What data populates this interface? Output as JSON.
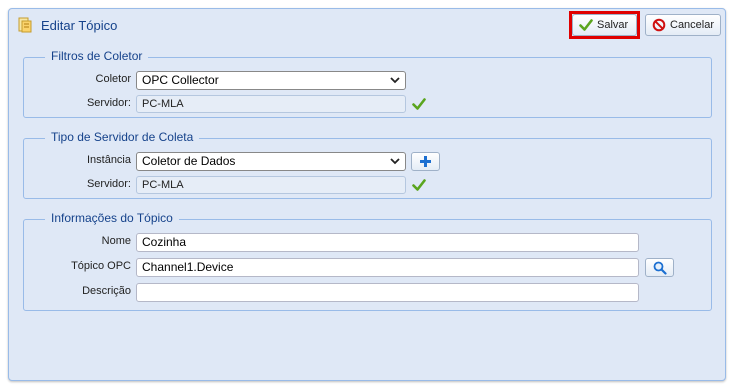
{
  "window": {
    "title": "Editar Tópico"
  },
  "toolbar": {
    "save_label": "Salvar",
    "cancel_label": "Cancelar"
  },
  "filters": {
    "legend": "Filtros de Coletor",
    "collector_label": "Coletor",
    "collector_value": "OPC Collector",
    "server_label": "Servidor:",
    "server_value": "PC-MLA"
  },
  "server_type": {
    "legend": "Tipo de Servidor de Coleta",
    "instance_label": "Instância",
    "instance_value": "Coletor de Dados",
    "server_label": "Servidor:",
    "server_value": "PC-MLA"
  },
  "topic_info": {
    "legend": "Informações do Tópico",
    "name_label": "Nome",
    "name_value": "Cozinha",
    "opc_topic_label": "Tópico OPC",
    "opc_topic_value": "Channel1.Device",
    "description_label": "Descrição",
    "description_value": ""
  },
  "icons": {
    "title": "topic-folder-icon",
    "save": "checkmark-icon",
    "cancel": "prohibited-icon",
    "valid": "green-check-icon",
    "add": "plus-icon",
    "search": "magnifier-icon",
    "dropdown": "chevron-down-icon"
  },
  "colors": {
    "window_bg": "#dfe8f6",
    "title_text": "#15428b",
    "highlight": "#e00000",
    "check_green": "#5aa51e",
    "add_blue": "#1c6fd1",
    "cancel_red": "#d01010"
  }
}
